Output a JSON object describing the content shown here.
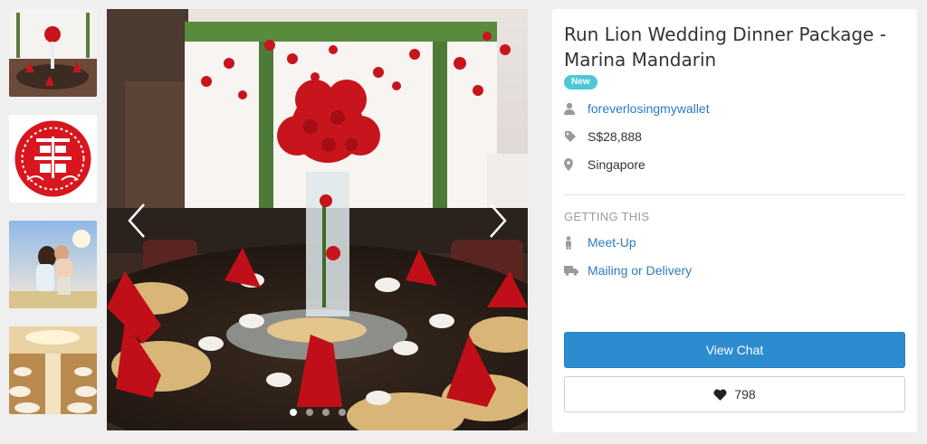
{
  "listing": {
    "title": "Run Lion Wedding Dinner Package - Marina Mandarin",
    "badge": "New",
    "seller": "foreverlosingmywallet",
    "price": "S$28,888",
    "location": "Singapore"
  },
  "getting": {
    "heading": "GETTING THIS",
    "options": [
      "Meet-Up",
      "Mailing or Delivery"
    ]
  },
  "actions": {
    "chat_label": "View Chat",
    "like_count": "798"
  },
  "gallery": {
    "thumbnail_count": 4,
    "dot_count": 4,
    "active_dot": 1
  },
  "colors": {
    "accent": "#2d8bd0",
    "link": "#2a7bc0",
    "badge": "#4fc6d6",
    "rose": "#c8141c"
  },
  "icons": [
    "user-icon",
    "price-tag-icon",
    "location-pin-icon",
    "person-icon",
    "truck-icon",
    "heart-icon",
    "chevron-left-icon",
    "chevron-right-icon"
  ]
}
